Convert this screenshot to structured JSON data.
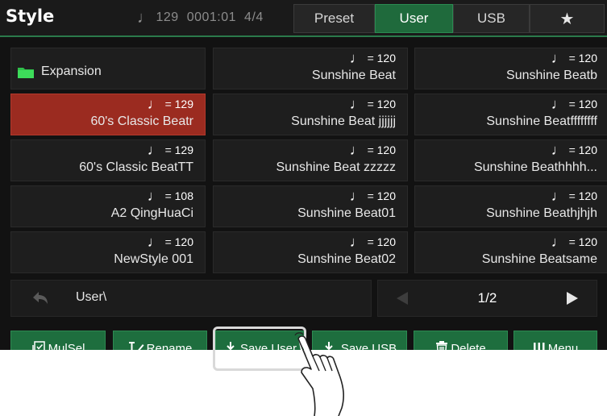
{
  "header": {
    "title": "Style",
    "status": {
      "tempo": "129",
      "position": "0001:01",
      "time_signature": "4/4"
    },
    "tabs": [
      {
        "label": "Preset",
        "active": false
      },
      {
        "label": "User",
        "active": true
      },
      {
        "label": "USB",
        "active": false
      },
      {
        "label": "",
        "icon": "star-icon",
        "active": false
      }
    ]
  },
  "grid": {
    "items": [
      {
        "tempo": "",
        "name": "Expansion",
        "type": "folder"
      },
      {
        "tempo": "= 120",
        "name": "Sunshine Beat"
      },
      {
        "tempo": "= 120",
        "name": "Sunshine Beatb"
      },
      {
        "tempo": "= 129",
        "name": "60's Classic Beatr",
        "selected": true
      },
      {
        "tempo": "= 120",
        "name": "Sunshine Beat jjjjjj"
      },
      {
        "tempo": "= 120",
        "name": "Sunshine Beatffffffff"
      },
      {
        "tempo": "= 129",
        "name": "60's Classic BeatTT"
      },
      {
        "tempo": "= 120",
        "name": "Sunshine Beat zzzzz"
      },
      {
        "tempo": "= 120",
        "name": "Sunshine Beathhhh..."
      },
      {
        "tempo": "= 108",
        "name": "A2 QingHuaCi"
      },
      {
        "tempo": "= 120",
        "name": "Sunshine Beat01"
      },
      {
        "tempo": "= 120",
        "name": "Sunshine Beathjhjh"
      },
      {
        "tempo": "= 120",
        "name": "NewStyle 001"
      },
      {
        "tempo": "= 120",
        "name": "Sunshine Beat02"
      },
      {
        "tempo": "= 120",
        "name": "Sunshine Beatsame"
      }
    ]
  },
  "pathbar": {
    "path": "User\\"
  },
  "pager": {
    "page": "1/2"
  },
  "toolbar": {
    "mulsel": "MulSel",
    "rename": "Rename",
    "save_user": "Save User",
    "save_usb": "Save USB",
    "delete": "Delete",
    "menu": "Menu"
  },
  "colors": {
    "accent_green": "#1e6e3e",
    "selected_red": "#9b2b20",
    "folder_green": "#2fbf4a",
    "background": "#121212"
  }
}
